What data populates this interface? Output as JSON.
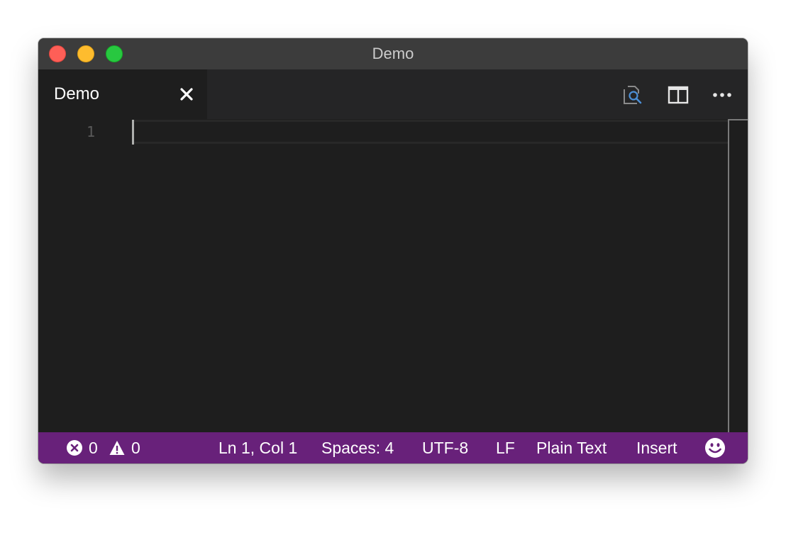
{
  "window": {
    "title": "Demo"
  },
  "tabs": [
    {
      "label": "Demo",
      "active": true
    }
  ],
  "tab_actions": [
    {
      "icon": "open-preview-icon"
    },
    {
      "icon": "split-editor-icon"
    },
    {
      "icon": "more-actions-icon"
    }
  ],
  "editor": {
    "line_numbers": [
      "1"
    ],
    "content": ""
  },
  "statusbar": {
    "errors": "0",
    "warnings": "0",
    "position": "Ln 1, Col 1",
    "indentation": "Spaces: 4",
    "encoding": "UTF-8",
    "line_ending": "LF",
    "language": "Plain Text",
    "mode": "Insert"
  },
  "colors": {
    "statusbar_bg": "#68217a",
    "editor_bg": "#1e1e1e",
    "titlebar_bg": "#3c3c3c",
    "tabbar_bg": "#252526"
  }
}
